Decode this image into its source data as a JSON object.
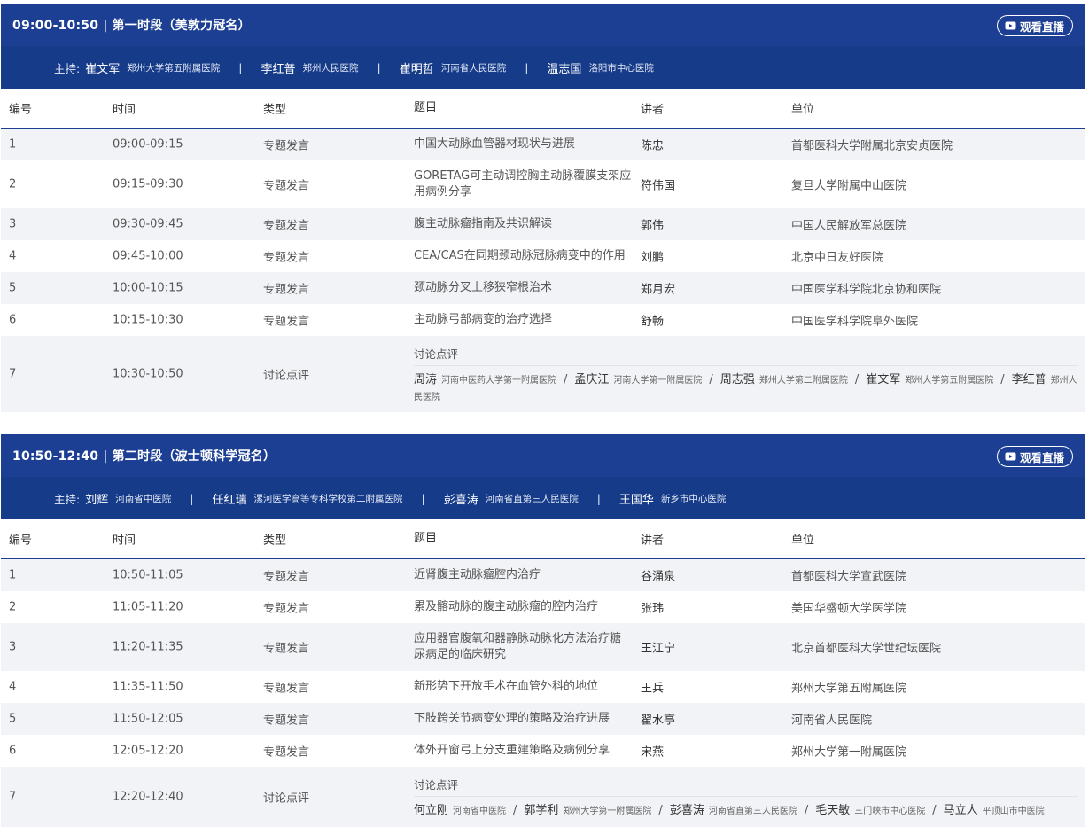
{
  "live_label": "观看直播",
  "host_label": "主持:",
  "columns": [
    "编号",
    "时间",
    "类型",
    "题目",
    "讲者",
    "单位"
  ],
  "sessions": [
    {
      "title": "09:00-10:50 | 第一时段（美敦力冠名）",
      "hosts": [
        {
          "name": "崔文军",
          "unit": "郑州大学第五附属医院"
        },
        {
          "name": "李红普",
          "unit": "郑州人民医院"
        },
        {
          "name": "崔明哲",
          "unit": "河南省人民医院"
        },
        {
          "name": "温志国",
          "unit": "洛阳市中心医院"
        }
      ],
      "rows": [
        {
          "no": "1",
          "time": "09:00-09:15",
          "type": "专题发言",
          "topic": "中国大动脉血管器材现状与进展",
          "speaker": "陈忠",
          "unit": "首都医科大学附属北京安贞医院"
        },
        {
          "no": "2",
          "time": "09:15-09:30",
          "type": "专题发言",
          "topic": "GORETAG可主动调控胸主动脉覆膜支架应用病例分享",
          "speaker": "符伟国",
          "unit": "复旦大学附属中山医院"
        },
        {
          "no": "3",
          "time": "09:30-09:45",
          "type": "专题发言",
          "topic": "腹主动脉瘤指南及共识解读",
          "speaker": "郭伟",
          "unit": "中国人民解放军总医院"
        },
        {
          "no": "4",
          "time": "09:45-10:00",
          "type": "专题发言",
          "topic": "CEA/CAS在同期颈动脉冠脉病变中的作用",
          "speaker": "刘鹏",
          "unit": "北京中日友好医院"
        },
        {
          "no": "5",
          "time": "10:00-10:15",
          "type": "专题发言",
          "topic": "颈动脉分叉上移狭窄根治术",
          "speaker": "郑月宏",
          "unit": "中国医学科学院北京协和医院"
        },
        {
          "no": "6",
          "time": "10:15-10:30",
          "type": "专题发言",
          "topic": "主动脉弓部病变的治疗选择",
          "speaker": "舒畅",
          "unit": "中国医学科学院阜外医院"
        }
      ],
      "discussion": {
        "no": "7",
        "time": "10:30-10:50",
        "type": "讨论点评",
        "label": "讨论点评",
        "people": [
          {
            "name": "周涛",
            "unit": "河南中医药大学第一附属医院"
          },
          {
            "name": "孟庆江",
            "unit": "河南大学第一附属医院"
          },
          {
            "name": "周志强",
            "unit": "郑州大学第二附属医院"
          },
          {
            "name": "崔文军",
            "unit": "郑州大学第五附属医院"
          },
          {
            "name": "李红普",
            "unit": "郑州人民医院"
          }
        ]
      }
    },
    {
      "title": "10:50-12:40 | 第二时段（波士顿科学冠名）",
      "hosts": [
        {
          "name": "刘辉",
          "unit": "河南省中医院"
        },
        {
          "name": "任红瑞",
          "unit": "漯河医学高等专科学校第二附属医院"
        },
        {
          "name": "彭喜涛",
          "unit": "河南省直第三人民医院"
        },
        {
          "name": "王国华",
          "unit": "新乡市中心医院"
        }
      ],
      "rows": [
        {
          "no": "1",
          "time": "10:50-11:05",
          "type": "专题发言",
          "topic": "近肾腹主动脉瘤腔内治疗",
          "speaker": "谷涌泉",
          "unit": "首都医科大学宣武医院"
        },
        {
          "no": "2",
          "time": "11:05-11:20",
          "type": "专题发言",
          "topic": "累及髂动脉的腹主动脉瘤的腔内治疗",
          "speaker": "张玮",
          "unit": "美国华盛顿大学医学院"
        },
        {
          "no": "3",
          "time": "11:20-11:35",
          "type": "专题发言",
          "topic": "应用器官腹氧和器静脉动脉化方法治疗糖尿病足的临床研究",
          "speaker": "王江宁",
          "unit": "北京首都医科大学世纪坛医院"
        },
        {
          "no": "4",
          "time": "11:35-11:50",
          "type": "专题发言",
          "topic": "新形势下开放手术在血管外科的地位",
          "speaker": "王兵",
          "unit": "郑州大学第五附属医院"
        },
        {
          "no": "5",
          "time": "11:50-12:05",
          "type": "专题发言",
          "topic": "下肢跨关节病变处理的策略及治疗进展",
          "speaker": "翟水亭",
          "unit": "河南省人民医院"
        },
        {
          "no": "6",
          "time": "12:05-12:20",
          "type": "专题发言",
          "topic": "体外开窗弓上分支重建策略及病例分享",
          "speaker": "宋燕",
          "unit": "郑州大学第一附属医院"
        }
      ],
      "discussion": {
        "no": "7",
        "time": "12:20-12:40",
        "type": "讨论点评",
        "label": "讨论点评",
        "people": [
          {
            "name": "何立刚",
            "unit": "河南省中医院"
          },
          {
            "name": "郭学利",
            "unit": "郑州大学第一附属医院"
          },
          {
            "name": "彭喜涛",
            "unit": "河南省直第三人民医院"
          },
          {
            "name": "毛天敏",
            "unit": "三门峡市中心医院"
          },
          {
            "name": "马立人",
            "unit": "平顶山市中医院"
          }
        ]
      }
    }
  ]
}
